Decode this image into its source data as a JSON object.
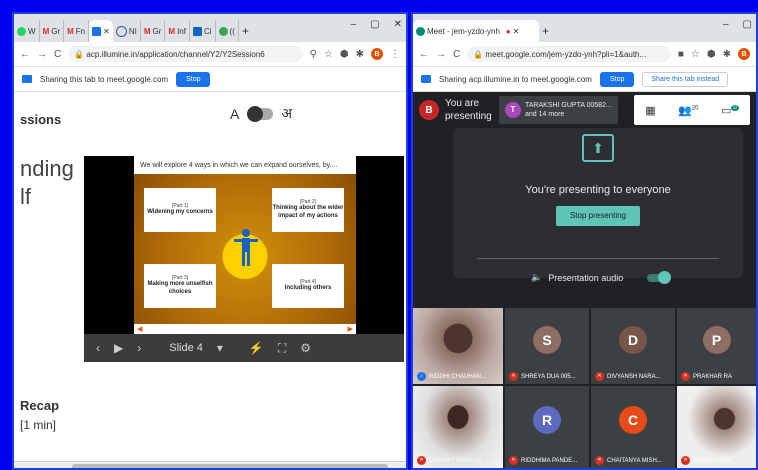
{
  "left_window": {
    "tabs": [
      "W",
      "Gr",
      "Fn",
      "",
      "NI",
      "Gr",
      "Inf",
      "Ci",
      "(("
    ],
    "url": "acp.illumine.in/application/channel/Y2/Y2Session6",
    "share_text": "Sharing this tab to meet.google.com",
    "stop_label": "Stop",
    "page": {
      "sessions_label": "ssions",
      "lang_a": "A",
      "lang_hindi": "अ",
      "heading_line1": "nding",
      "heading_line2": "lf",
      "slide": {
        "header": "We will explore 4 ways in which we can expand ourselves, by....",
        "cards": [
          {
            "part": "[Part 1]",
            "title": "Widening my concerns"
          },
          {
            "part": "[Part 2]",
            "title": "Thinking about the wider impact of my actions"
          },
          {
            "part": "[Part 3]",
            "title": "Making more unselfish choices"
          },
          {
            "part": "[Part 4]",
            "title": "Including others"
          }
        ],
        "slide_number": "Slide 4"
      },
      "recap": "Recap",
      "recap_time": "[1 min]"
    }
  },
  "right_window": {
    "tab_title": "Meet - jem-yzdo-ynh",
    "url": "meet.google.com/jem-yzdo-ynh?pli=1&auth...",
    "share_text": "Sharing acp.illumine.in to meet.google.com",
    "stop_label": "Stop",
    "share_instead_label": "Share this tab instead",
    "presenter_avatar": "B",
    "you_are_presenting": "You are presenting",
    "pinned": {
      "initial": "T",
      "name": "TARAKSHI GUPTA 00582...",
      "more": "and 14 more"
    },
    "participants_count": "20",
    "chat_badge": "0",
    "presenting_title": "You're presenting to everyone",
    "stop_presenting_label": "Stop presenting",
    "presentation_audio_label": "Presentation audio",
    "participants": [
      {
        "name": "RIDDHI CHAUHAN...",
        "initial": "",
        "color": "",
        "video": true
      },
      {
        "name": "SHREYA DUA 005...",
        "initial": "S",
        "color": "#8d6e63"
      },
      {
        "name": "DIVYANSH NARA...",
        "initial": "D",
        "color": "#795548"
      },
      {
        "name": "PRAKHAR RA",
        "initial": "P",
        "color": "#8d6e63"
      },
      {
        "name": "CHERRY 00557-12",
        "initial": "",
        "color": "",
        "video": true
      },
      {
        "name": "RIDDHIMA PANDE...",
        "initial": "R",
        "color": "#5c6bc0"
      },
      {
        "name": "CHAITANYA MISH...",
        "initial": "C",
        "color": "#e64a19"
      },
      {
        "name": "SHRISTI SHA",
        "initial": "",
        "color": "",
        "video": true
      }
    ]
  }
}
